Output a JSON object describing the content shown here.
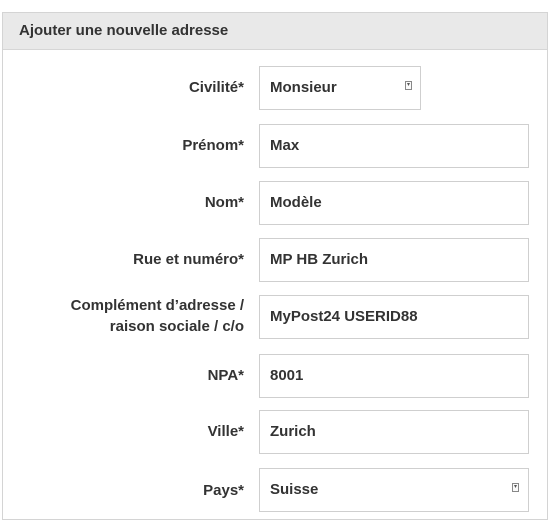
{
  "form": {
    "title": "Ajouter une nouvelle adresse",
    "fields": [
      {
        "label": "Civilité*",
        "value": "Monsieur",
        "type": "select",
        "icon": "select-dropdown-icon"
      },
      {
        "label": "Prénom*",
        "value": "Max",
        "type": "text"
      },
      {
        "label": "Nom*",
        "value": "Modèle",
        "type": "text"
      },
      {
        "label": "Rue et numéro*",
        "value": "MP HB Zurich",
        "type": "text"
      },
      {
        "label_line1": "Complément d’adresse /",
        "label_line2": "raison sociale / c/o",
        "value": "MyPost24 USERID88",
        "type": "text"
      },
      {
        "label": "NPA*",
        "value": "8001",
        "type": "text"
      },
      {
        "label": "Ville*",
        "value": "Zurich",
        "type": "text"
      },
      {
        "label": "Pays*",
        "value": "Suisse",
        "type": "select",
        "icon": "select-dropdown-icon"
      }
    ]
  }
}
